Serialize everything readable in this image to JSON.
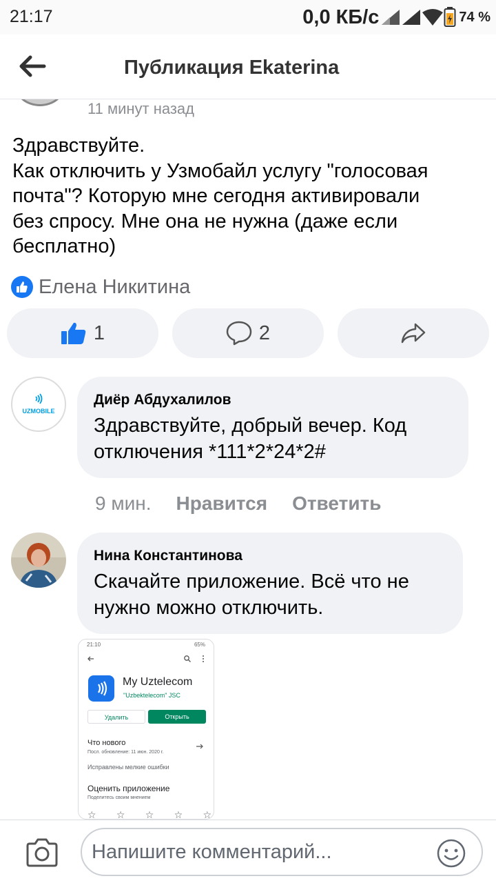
{
  "status_bar": {
    "time": "21:17",
    "net_speed": "0,0 КБ/с",
    "battery": "74 %"
  },
  "header": {
    "title": "Публикация Ekaterina"
  },
  "post": {
    "time": "11 минут назад",
    "lines": [
      "Здравствуйте.",
      "Как отключить у Узмобайл услугу \"голосовая",
      "почта\"? Которую мне сегодня активировали",
      "без спросу. Мне она не нужна (даже если",
      "бесплатно)"
    ],
    "reactor": "Елена Никитина",
    "likes": "1",
    "comments": "2"
  },
  "comments": [
    {
      "author": "Диёр Абдухалилов",
      "avatar_text": "UZMOBILE",
      "lines": [
        "Здравствуйте, добрый вечер.  Код",
        "отключения *111*2*24*2#"
      ],
      "time": "9 мин.",
      "like": "Нравится",
      "reply": "Ответить"
    },
    {
      "author": "Нина Константинова",
      "lines": [
        "Скачайте приложение. Всё что не",
        "нужно можно отключить."
      ]
    }
  ],
  "attachment": {
    "status_left": "21:10",
    "status_right": "65%",
    "app_name": "My Uztelecom",
    "developer": "\"Uzbektelecom\" JSC",
    "remove": "Удалить",
    "open": "Открыть",
    "whats_new": "Что нового",
    "updated": "Посл. обновление: 11 июн. 2020 г.",
    "fixes": "Исправлены мелкие ошибки",
    "rate": "Оценить приложение",
    "rate_sub": "Поделитесь своим мнением"
  },
  "composer": {
    "placeholder": "Напишите комментарий..."
  },
  "colors": {
    "accent": "#1877f2",
    "bubble": "#f0f2f5",
    "muted": "#8a8d91",
    "uzmobile": "#00a0e3"
  }
}
